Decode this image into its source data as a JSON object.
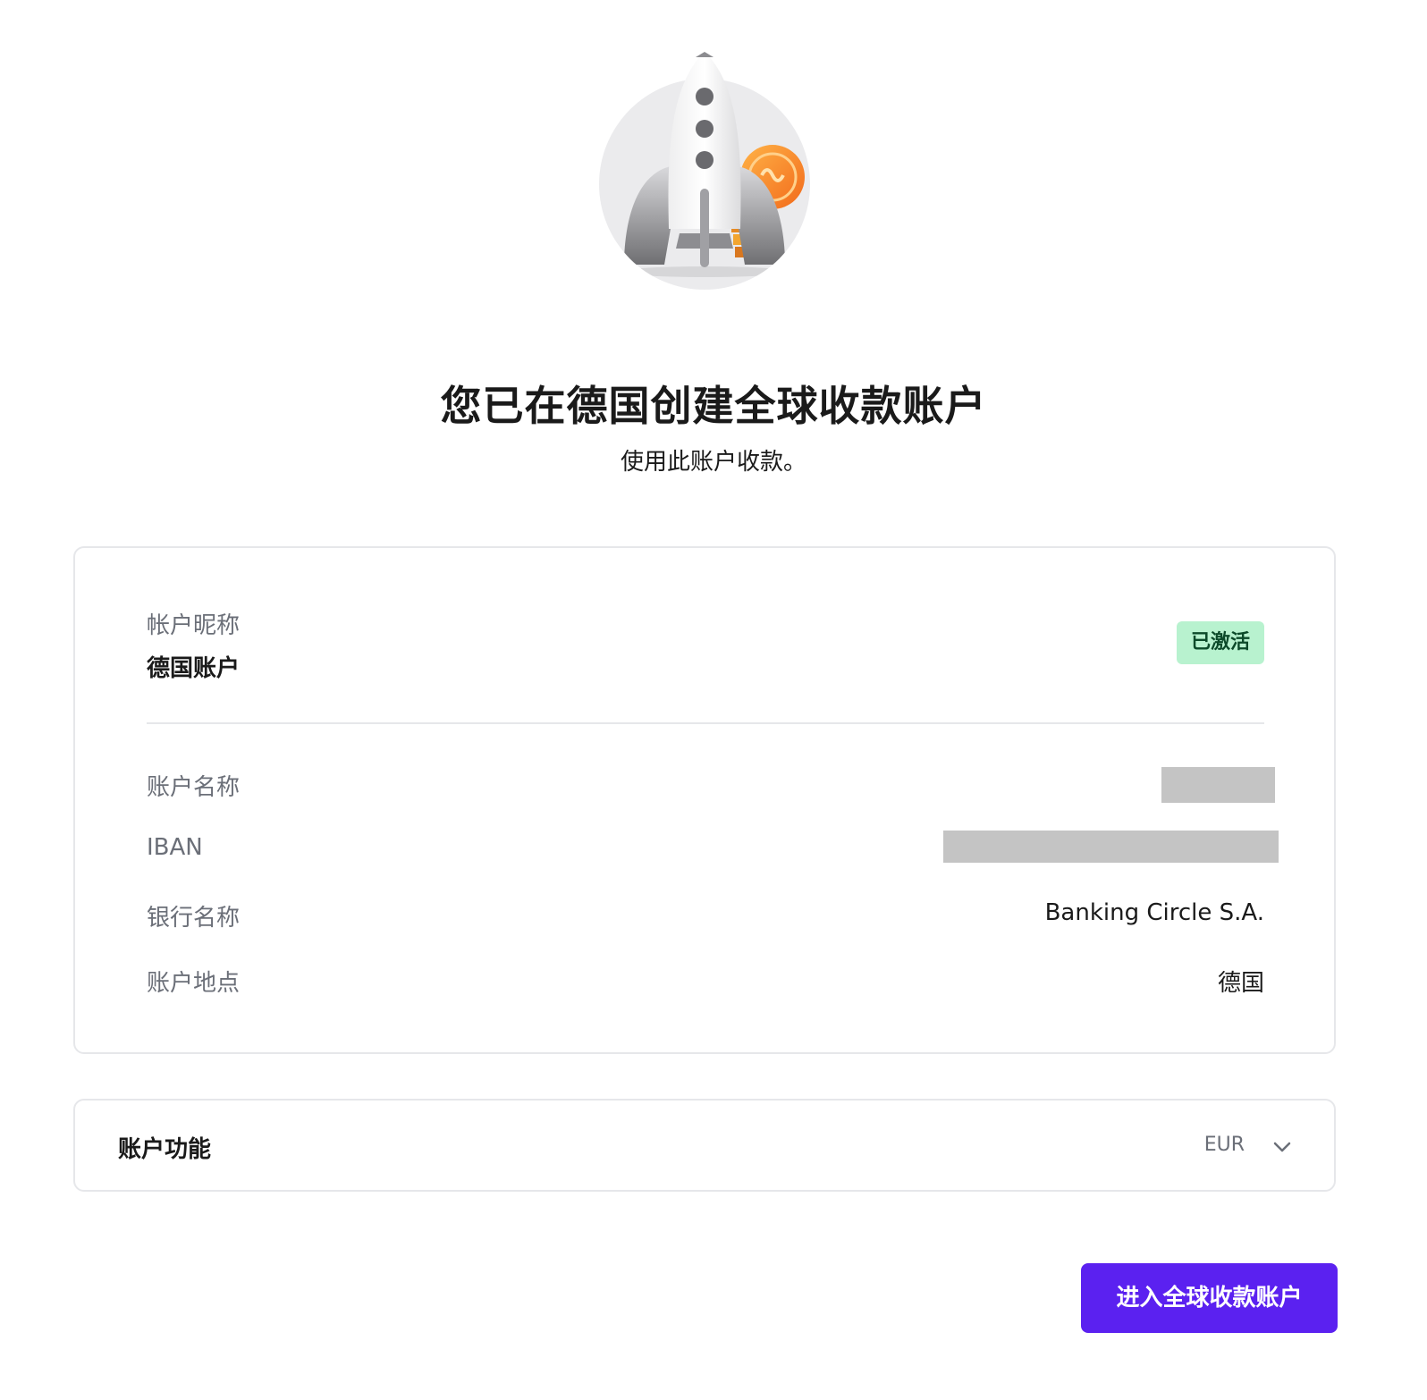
{
  "header": {
    "title": "您已在德国创建全球收款账户",
    "subtitle": "使用此账户收款。"
  },
  "account_card": {
    "nickname_label": "帐户昵称",
    "nickname_value": "德国账户",
    "status_badge": "已激活",
    "rows": [
      {
        "label": "账户名称",
        "value": "",
        "redacted": true
      },
      {
        "label": "IBAN",
        "value": "",
        "redacted": true
      },
      {
        "label": "银行名称",
        "value": "Banking Circle S.A."
      },
      {
        "label": "账户地点",
        "value": "德国"
      }
    ]
  },
  "features_card": {
    "heading": "账户功能",
    "currency": "EUR",
    "icon": "chevron-down-icon"
  },
  "cta": {
    "label": "进入全球收款账户"
  },
  "colors": {
    "accent": "#5b21f0",
    "badge_bg": "#b8f2cf",
    "badge_text": "#0c4a2a",
    "muted_text": "#6b6f78",
    "border": "#e6e7ea"
  }
}
